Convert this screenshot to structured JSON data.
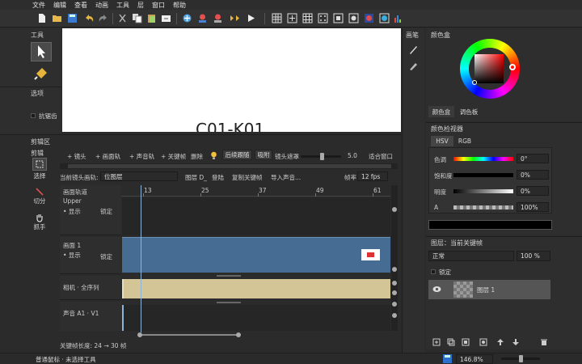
{
  "menu": [
    "文件",
    "编辑",
    "查看",
    "动画",
    "工具",
    "层",
    "窗口",
    "帮助"
  ],
  "tools_panel": {
    "title": "工具",
    "options_title": "选项",
    "antialias_label": "抗锯齿"
  },
  "canvas": {
    "text": "C01-K01"
  },
  "brush_panel": {
    "title": "画笔"
  },
  "color_box": {
    "title": "颜色盒",
    "tabs": [
      "颜色盒",
      "调色板"
    ]
  },
  "color_inspector": {
    "title": "颜色检视器",
    "tabs": [
      "HSV",
      "RGB"
    ],
    "rows": [
      {
        "label": "色调",
        "value": "0°"
      },
      {
        "label": "饱和度",
        "value": "0%"
      },
      {
        "label": "明度",
        "value": "0%"
      },
      {
        "label": "A",
        "value": "100%"
      }
    ]
  },
  "layers_panel": {
    "title": "图层：当前关键帧",
    "blend_mode": "正常",
    "opacity": "100 %",
    "lock_label": "锁定",
    "layer_name": "图层 1"
  },
  "cut_panel": {
    "title": "剪辑区",
    "sub_title": "剪辑",
    "tools": [
      "选择",
      "切分",
      "抓手"
    ],
    "toolbar": [
      "+ 镜头",
      "+ 画面轨",
      "+ 声音轨",
      "+ 关键帧",
      "删除"
    ],
    "continuous_follow": "后续跟随",
    "snap": "吸附",
    "lens_mask": "镜头遮罩",
    "lens_mask_value": "5.0",
    "fit_window": "适合窗口",
    "current_track_label": "当前镜头画轨:",
    "current_track_value": "位图层",
    "layer_d": "图层 D_",
    "login": "登陆",
    "copy_keyframe": "复制关键帧",
    "import_sound": "导入声音...",
    "frame_rate_label": "帧率",
    "frame_rate": "12 fps",
    "ruler_ticks": [
      "13",
      "25",
      "37",
      "49",
      "61"
    ],
    "tracks": [
      {
        "name": "画面轨道",
        "sub": "Upper",
        "show": "• 显示",
        "lock": "锁定"
      },
      {
        "name": "画面 1",
        "show": "• 显示",
        "lock": "锁定"
      },
      {
        "name": "相机 · 全序列"
      },
      {
        "name": "声音 A1 · V1"
      }
    ],
    "keyframe_length": "关键帧长度: 24 → 30 帧"
  },
  "status": {
    "text": "普通鼠标 · 未选择工具",
    "zoom": "146.8%"
  },
  "colors": {
    "accent": "#3a6aa0",
    "track_blue": "#466c94",
    "camera_track": "#d4c596",
    "panel": "#2b2b2b"
  }
}
